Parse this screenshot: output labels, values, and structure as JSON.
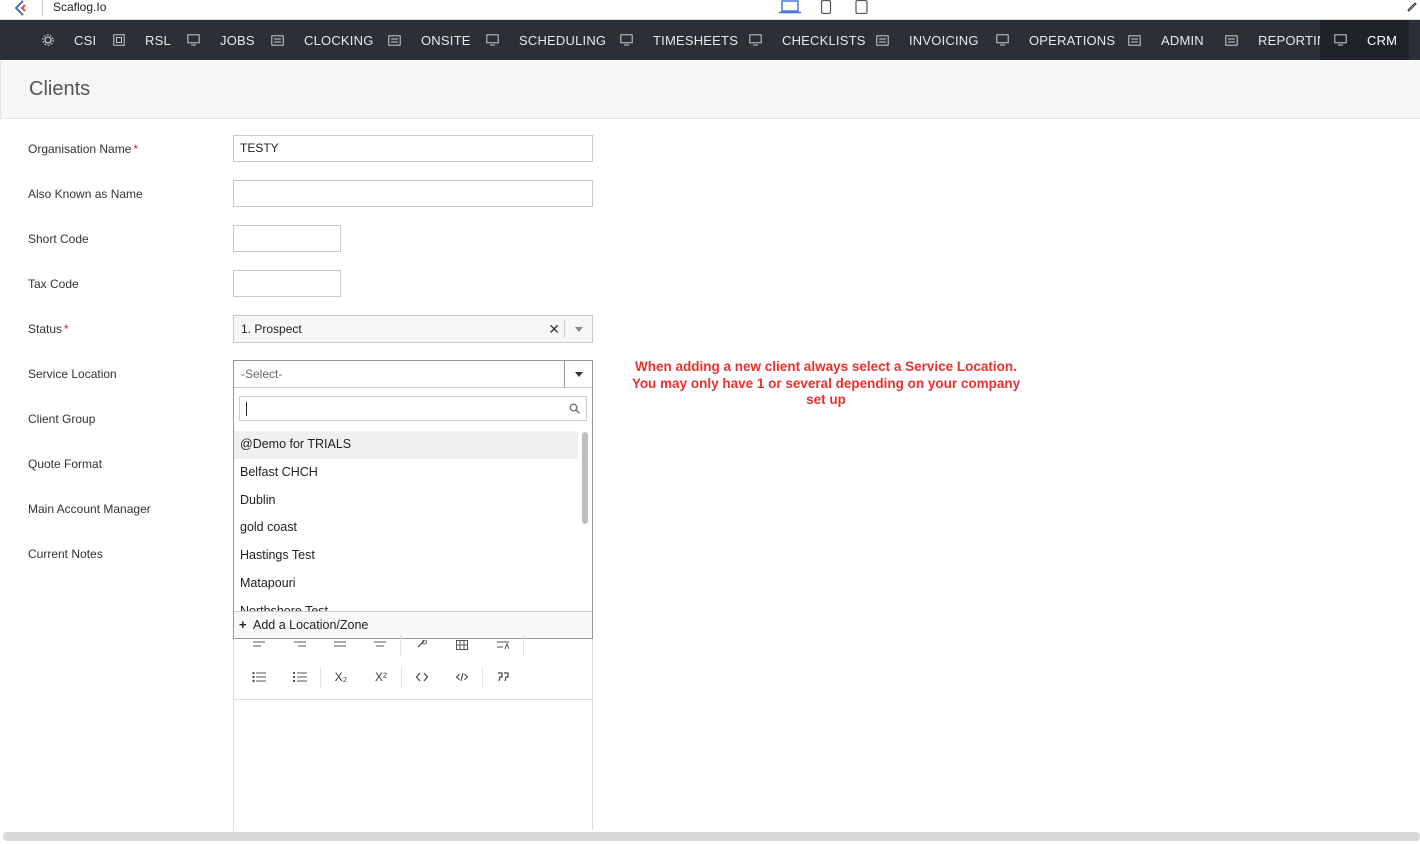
{
  "window": {
    "title": "Scaflog.Io"
  },
  "colors": {
    "nav_bg": "#2b3037",
    "note_red": "#e8322e",
    "required": "#d9242a"
  },
  "nav": {
    "items": [
      {
        "label": "CSI",
        "icon": "gear-icon"
      },
      {
        "label": "RSL",
        "icon": "box-icon"
      },
      {
        "label": "JOBS",
        "icon": "monitor-icon"
      },
      {
        "label": "CLOCKING",
        "icon": "panel-icon"
      },
      {
        "label": "ONSITE",
        "icon": "panel-icon"
      },
      {
        "label": "SCHEDULING",
        "icon": "monitor-icon"
      },
      {
        "label": "TIMESHEETS",
        "icon": "monitor-icon"
      },
      {
        "label": "CHECKLISTS",
        "icon": "monitor-icon"
      },
      {
        "label": "INVOICING",
        "icon": "panel-icon"
      },
      {
        "label": "OPERATIONS",
        "icon": "monitor-icon"
      },
      {
        "label": "ADMIN",
        "icon": "panel-icon"
      },
      {
        "label": "REPORTING",
        "icon": "panel-icon"
      },
      {
        "label": "CRM",
        "icon": "monitor-icon",
        "active": true
      }
    ]
  },
  "page": {
    "title": "Clients"
  },
  "form": {
    "organisation_name": {
      "label": "Organisation Name",
      "value": "TESTY",
      "required_mark": "*"
    },
    "also_known_as": {
      "label": "Also Known as Name",
      "value": ""
    },
    "short_code": {
      "label": "Short Code",
      "value": ""
    },
    "tax_code": {
      "label": "Tax Code",
      "value": ""
    },
    "status": {
      "label": "Status",
      "value": "1. Prospect",
      "required_mark": "*",
      "clear": "✕"
    },
    "service_location": {
      "label": "Service Location",
      "value": "-Select-"
    },
    "client_group": {
      "label": "Client Group"
    },
    "quote_format": {
      "label": "Quote Format"
    },
    "main_account_manager": {
      "label": "Main Account Manager"
    },
    "current_notes": {
      "label": "Current Notes"
    }
  },
  "dropdown": {
    "search_value": "",
    "options": [
      "@Demo for TRIALS",
      "Belfast CHCH",
      "Dublin",
      "gold coast",
      "Hastings Test",
      "Matapouri",
      "Northshore Test"
    ],
    "highlighted_index": 0,
    "add_label": "Add a Location/Zone",
    "add_symbol": "+"
  },
  "note": {
    "text": "When adding a new client always select a Service Location. You may only have 1 or several depending on your company set up"
  },
  "editor": {
    "toolbar_row2": [
      "bulleted-list-icon",
      "numbered-list-icon",
      "subscript-icon",
      "superscript-icon",
      "code-icon",
      "source-code-icon",
      "blockquote-icon"
    ],
    "subscript_label": "X₂",
    "superscript_label": "X²"
  }
}
